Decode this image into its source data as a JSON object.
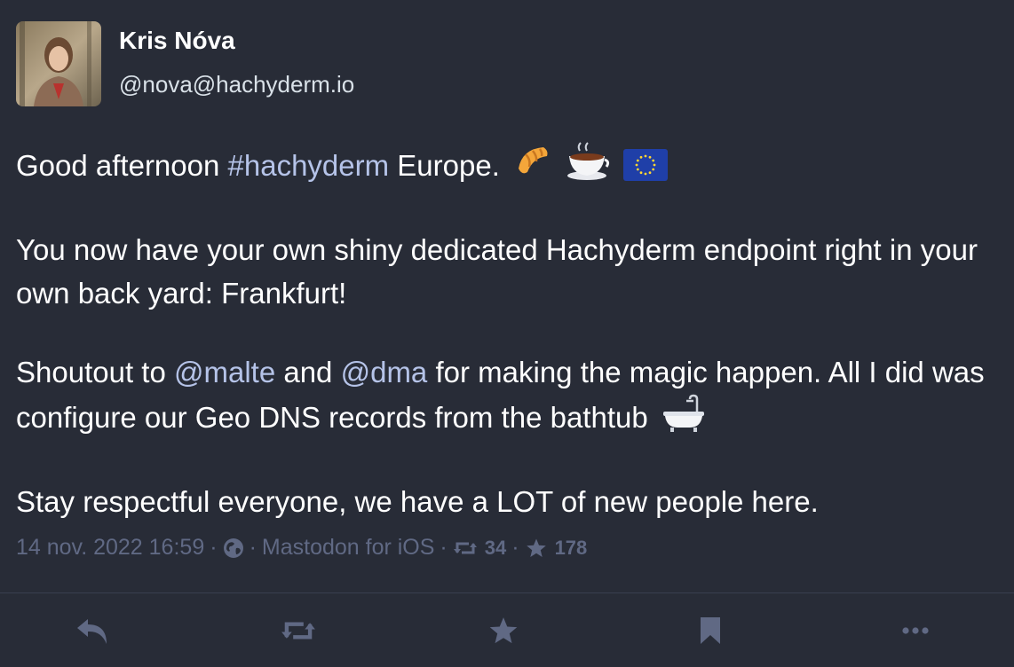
{
  "post": {
    "author": {
      "display_name": "Kris Nóva",
      "handle": "@nova@hachyderm.io",
      "avatar_icon": "avatar-photo"
    },
    "content": {
      "p1": {
        "before": "Good afternoon ",
        "hashtag": "#hachyderm",
        "after": " Europe.",
        "emojis": [
          "croissant",
          "hot-beverage",
          "eu-flag"
        ]
      },
      "p2": "You now have your own shiny dedicated Hachyderm endpoint right in your own back yard: Frankfurt!",
      "p3": {
        "before": "Shoutout to ",
        "mention1": "@malte",
        "middle": " and ",
        "mention2": "@dma",
        "after": " for making the magic happen. All I did was configure our Geo DNS records from the bathtub",
        "emoji": "bathtub"
      },
      "p4": "Stay respectful everyone, we have a LOT of new people here."
    },
    "meta": {
      "timestamp": "14 nov. 2022 16:59",
      "separator": "·",
      "visibility_icon": "globe-icon",
      "client": "Mastodon for iOS",
      "boosts": "34",
      "favourites": "178"
    }
  },
  "actions": [
    "reply",
    "boost",
    "favourite",
    "bookmark",
    "more"
  ],
  "colors": {
    "background": "#282c37",
    "text": "#ffffff",
    "secondary": "#d9e1e8",
    "link": "#b5c3e8",
    "muted": "#606984"
  }
}
